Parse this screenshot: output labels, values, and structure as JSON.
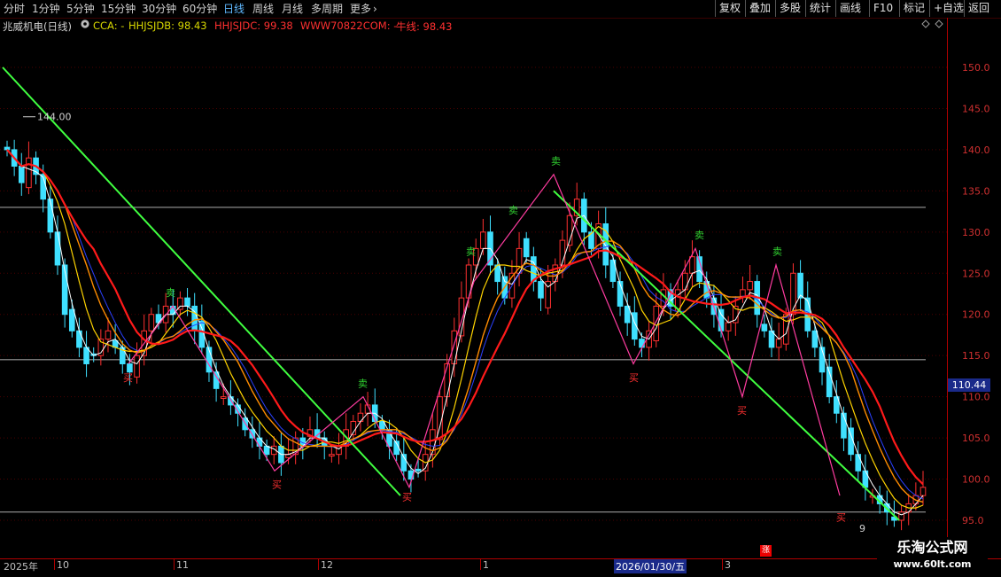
{
  "toolbar": {
    "tabs": [
      "分时",
      "1分钟",
      "5分钟",
      "15分钟",
      "30分钟",
      "60分钟",
      "日线",
      "周线",
      "月线",
      "多周期",
      "更多"
    ],
    "active_tab": "日线",
    "more_chevron": "chevron-right-icon",
    "right_buttons": [
      "复权",
      "叠加",
      "多股",
      "统计",
      "画线",
      "F10",
      "标记",
      "+自选",
      "返回"
    ]
  },
  "info": {
    "stock_name": "兆威机电(日线)",
    "settings_icon": "gear-icon",
    "indicators": [
      {
        "label": "CCA: -",
        "color": "#d8d800"
      },
      {
        "label": "HHJSJDB: 98.43",
        "color": "#d8d800"
      },
      {
        "label": "HHJSJDC: 99.38",
        "color": "#ff3030"
      },
      {
        "label": "WWW70822COM: -",
        "color": "#ff3030"
      },
      {
        "label": "牛线: 98.43",
        "color": "#ff3030"
      }
    ],
    "diamond_icons": [
      "diamond-icon",
      "diamond-icon"
    ]
  },
  "price_axis": {
    "labels": [
      "150.0",
      "145.0",
      "140.0",
      "135.0",
      "130.0",
      "125.0",
      "120.0",
      "115.0",
      "110.0",
      "105.0",
      "100.0",
      "95.0"
    ],
    "current_price": "110.44"
  },
  "chart_annotations": {
    "high_label": "144.00",
    "low_label": "9",
    "buy_label": "买",
    "sell_label": "卖"
  },
  "date_axis": {
    "labels": [
      "2025年",
      "10",
      "11",
      "12",
      "1",
      "3"
    ],
    "current_date": "2026/01/30/五",
    "up_badge": "涨"
  },
  "watermark": {
    "title": "乐淘公式网",
    "url": "www.60lt.com"
  },
  "chart_data": {
    "type": "candlestick",
    "title": "兆威机电(日线)",
    "ylim": [
      93,
      155
    ],
    "y_ticks": [
      95,
      100,
      105,
      110,
      115,
      120,
      125,
      130,
      135,
      140,
      145,
      150
    ],
    "horizontal_lines": [
      133,
      114.5,
      96
    ],
    "period_labels": [
      "2025年",
      "10",
      "11",
      "12",
      "1",
      "2026/01/30/五",
      "3"
    ],
    "highlighted_price": 110.44,
    "marked_high": 144.0,
    "colors": {
      "up": "#ff3030",
      "down": "#3fe0ff",
      "ma_fast": "#ffffff",
      "ma_yellow": "#ffd400",
      "ma_orange": "#ff8c00",
      "ma_red": "#ff1a1a",
      "ma_blue": "#2a40ff",
      "trend": "#40ff40",
      "zigzag": "#ff3ca0"
    },
    "candles_close": [
      140,
      138,
      136,
      139,
      137,
      134,
      130,
      126,
      120,
      118,
      116,
      114,
      115,
      117,
      118,
      116,
      114,
      113,
      115,
      118,
      120,
      119,
      121,
      120,
      122,
      121,
      118,
      116,
      113,
      111,
      110,
      109,
      108,
      106,
      105,
      104,
      103,
      104,
      102,
      103,
      105,
      104,
      106,
      105,
      104,
      103,
      104,
      106,
      107,
      108,
      109,
      107,
      106,
      104,
      103,
      101,
      100,
      101,
      103,
      106,
      110,
      114,
      118,
      122,
      126,
      128,
      130,
      126,
      124,
      122,
      125,
      128,
      127,
      124,
      122,
      124,
      126,
      129,
      132,
      134,
      130,
      128,
      131,
      126,
      124,
      121,
      119,
      117,
      116,
      118,
      121,
      123,
      121,
      123,
      125,
      127,
      124,
      122,
      120,
      118,
      119,
      121,
      123,
      124,
      120,
      118,
      116,
      117,
      120,
      125,
      122,
      118,
      116,
      113,
      110,
      108,
      105,
      103,
      101,
      99,
      98,
      97,
      96,
      95,
      96,
      97,
      98,
      99
    ]
  }
}
